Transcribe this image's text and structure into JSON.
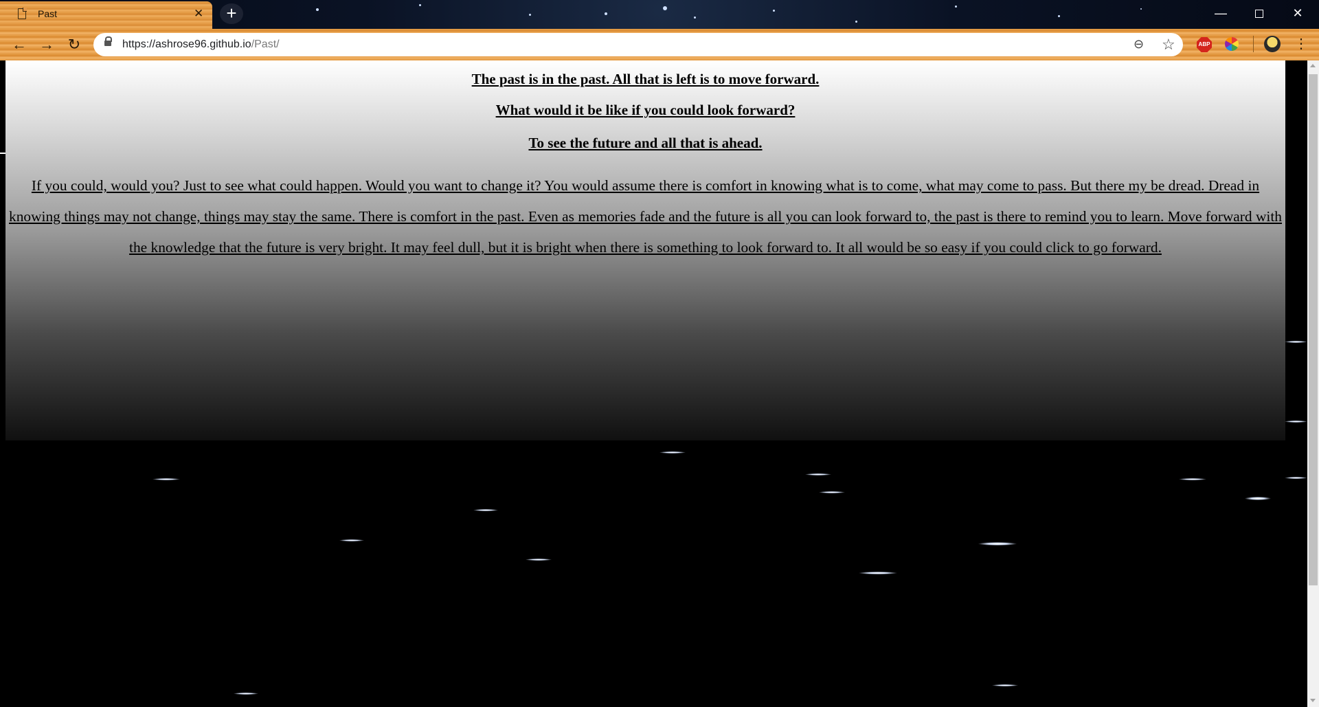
{
  "browser": {
    "tab": {
      "title": "Past",
      "close_glyph": "✕",
      "icon": "page-icon"
    },
    "new_tab_glyph": "+",
    "window_controls": {
      "minimize_glyph": "—",
      "close_glyph": "✕"
    },
    "nav": {
      "back_glyph": "←",
      "forward_glyph": "→",
      "reload_glyph": "↻"
    },
    "address_bar": {
      "host": "https://ashrose96.github.io",
      "path": "/Past/"
    },
    "toolbar_icons": {
      "zoom_glyph": "⊖",
      "bookmark_glyph": "☆",
      "adblock_label": "ABP",
      "menu_glyph": "⋮"
    },
    "theme": {
      "accent": "#e39a45",
      "titlebar": "#0a1224"
    }
  },
  "page": {
    "heading_1": "The past is in the past. All that is left is to move forward.",
    "heading_2": "What would it be like if you could look forward?",
    "heading_3": "To see the future and all that is ahead.",
    "paragraph": "If you could, would you? Just to see what could happen. Would you want to change it? You would assume there is comfort in knowing what is to come, what may come to pass. But there my be dread. Dread in knowing things may not change, things may stay the same. There is comfort in the past. Even as memories fade and the future is all you can look forward to, the past is there to remind you to learn. Move forward with the knowledge that the future is very bright. It may feel dull, but it is bright when there is something to look forward to. It all would be so easy if you could click to go forward."
  }
}
